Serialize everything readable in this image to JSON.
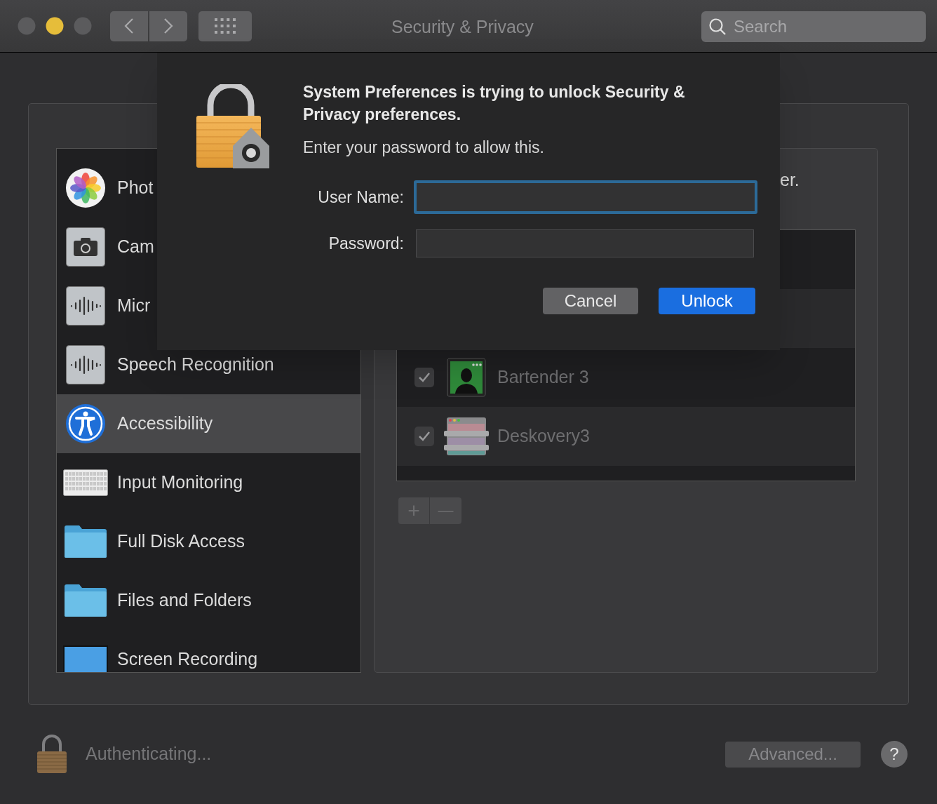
{
  "window": {
    "title": "Security & Privacy",
    "search": {
      "placeholder": "Search"
    }
  },
  "sidebar": {
    "items": [
      {
        "label": "Phot",
        "kind": "photos",
        "selected": false
      },
      {
        "label": "Cam",
        "kind": "camera",
        "selected": false
      },
      {
        "label": "Micr",
        "kind": "microphone",
        "selected": false
      },
      {
        "label": "Speech Recognition",
        "kind": "speech",
        "selected": false
      },
      {
        "label": "Accessibility",
        "kind": "accessibility",
        "selected": true
      },
      {
        "label": "Input Monitoring",
        "kind": "keyboard",
        "selected": false
      },
      {
        "label": "Full Disk Access",
        "kind": "folder",
        "selected": false
      },
      {
        "label": "Files and Folders",
        "kind": "folder",
        "selected": false
      },
      {
        "label": "Screen Recording",
        "kind": "screen",
        "selected": false
      }
    ]
  },
  "panel": {
    "caption": "er.",
    "apps": [
      {
        "name": "Bartender 3",
        "kind": "bartender",
        "checked": true
      },
      {
        "name": "Deskovery3",
        "kind": "deskovery",
        "checked": true
      }
    ],
    "list_buttons": [
      "+",
      "—"
    ]
  },
  "dialog": {
    "title": "System Preferences is trying to unlock Security & Privacy preferences.",
    "message": "Enter your password to allow this.",
    "fields": [
      {
        "label": "User Name:",
        "focused": true
      },
      {
        "label": "Password:",
        "focused": false
      }
    ],
    "buttons": [
      {
        "label": "Cancel",
        "kind": "secondary"
      },
      {
        "label": "Unlock",
        "kind": "default"
      }
    ]
  },
  "footer": {
    "status": "Authenticating...",
    "advanced": "Advanced...",
    "help": "?"
  }
}
